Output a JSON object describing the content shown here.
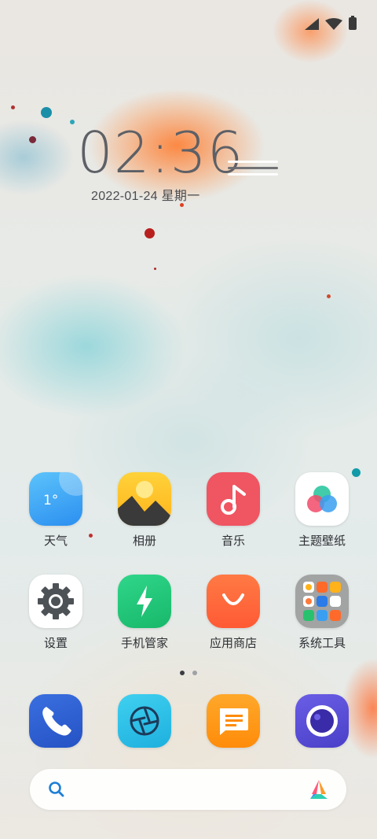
{
  "status_bar": {
    "icons": [
      "signal-icon",
      "wifi-icon",
      "battery-icon"
    ]
  },
  "clock": {
    "time": "02:36",
    "date": "2022-01-24 星期一"
  },
  "apps": [
    {
      "name": "weather",
      "label": "天气",
      "icon_text": "1°",
      "icon": "weather-icon"
    },
    {
      "name": "gallery",
      "label": "相册",
      "icon": "gallery-icon"
    },
    {
      "name": "music",
      "label": "音乐",
      "icon": "music-note-icon"
    },
    {
      "name": "theme",
      "label": "主题壁纸",
      "icon": "theme-icon"
    },
    {
      "name": "settings",
      "label": "设置",
      "icon": "gear-icon"
    },
    {
      "name": "phone-manager",
      "label": "手机管家",
      "icon": "lightning-icon"
    },
    {
      "name": "app-store",
      "label": "应用商店",
      "icon": "shopping-bag-icon"
    },
    {
      "name": "system-tools",
      "label": "系统工具",
      "icon": "folder-icon"
    }
  ],
  "pager": {
    "pages": 2,
    "current": 1
  },
  "dock": [
    {
      "name": "phone",
      "icon": "phone-icon"
    },
    {
      "name": "browser",
      "icon": "browser-icon"
    },
    {
      "name": "messages",
      "icon": "message-icon"
    },
    {
      "name": "camera",
      "icon": "camera-icon"
    }
  ],
  "search": {
    "icon": "search-icon",
    "assistant_icon": "assistant-icon"
  },
  "colors": {
    "weather": "#3fa9f5",
    "music": "#f05562",
    "phone_manager": "#27c97a",
    "app_store": "#ff6a3d",
    "dock_phone": "#2f5fcf",
    "dock_browser": "#2ec3e8",
    "dock_messages": "#ff9a12",
    "dock_camera": "#5b4fd6"
  }
}
